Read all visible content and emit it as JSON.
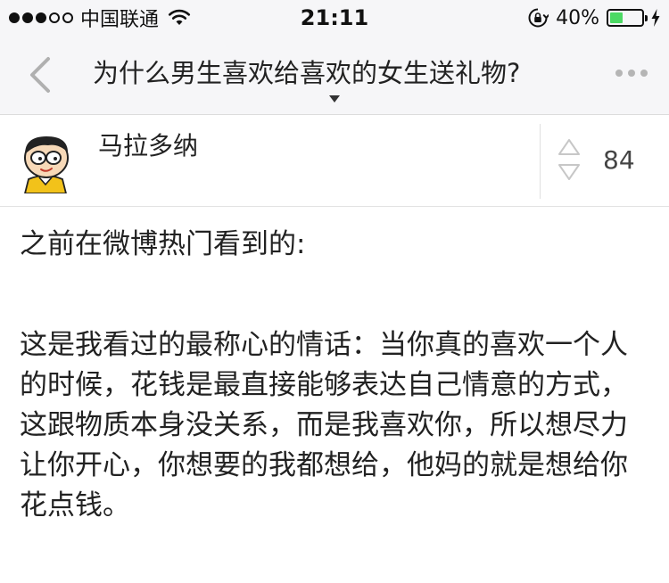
{
  "status_bar": {
    "carrier": "中国联通",
    "time": "21:11",
    "battery_percent": "40%",
    "battery_level": 0.4,
    "signal_bars_filled": 3,
    "signal_bars_total": 5
  },
  "nav": {
    "title": "为什么男生喜欢给喜欢的女生送礼物?",
    "back_icon": "chevron-left-icon",
    "more_icon": "more-dots-icon"
  },
  "author": {
    "name": "马拉多纳",
    "vote_count": "84"
  },
  "answer": {
    "intro": "之前在微博热门看到的:",
    "body": "这是我看过的最称心的情话：当你真的喜欢一个人的时候，花钱是最直接能够表达自己情意的方式，这跟物质本身没关系，而是我喜欢你，所以想尽力让你开心，你想要的我都想给，他妈的就是想给你花点钱。"
  },
  "colors": {
    "bar_background": "#f6f6f8",
    "battery_fill": "#4cd964",
    "text": "#222222"
  }
}
